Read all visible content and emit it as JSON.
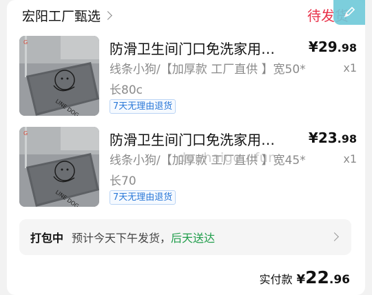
{
  "header": {
    "shop_name": "宏阳工厂甄选",
    "order_status": "待发货"
  },
  "items": [
    {
      "title": "防滑卫生间门口免洗家用…",
      "price_currency": "¥",
      "price_int": "29",
      "price_dec": ".98",
      "spec": "线条小狗/【加厚款 工厂直供 】宽50*长80c",
      "qty": "x1",
      "tag": "7天无理由退货",
      "image": "bath-mat-product-image"
    },
    {
      "title": "防滑卫生间门口免洗家用…",
      "price_currency": "¥",
      "price_int": "23",
      "price_dec": ".98",
      "spec": "线条小狗/【加厚款 工厂直供 】宽45*长70",
      "qty": "x1",
      "tag": "7天无理由退货",
      "image": "bath-mat-product-image"
    }
  ],
  "shipping": {
    "label": "打包中",
    "note": "预计今天下午发货，",
    "highlight": "后天送达"
  },
  "total": {
    "label": "实付款",
    "currency": "¥",
    "int": "22",
    "dec": ".96"
  },
  "watermark": "douhaigou.fun",
  "colors": {
    "status_red": "#e8324a",
    "tag_blue": "#2a78d8",
    "delivery_green": "#1f9d4a"
  }
}
